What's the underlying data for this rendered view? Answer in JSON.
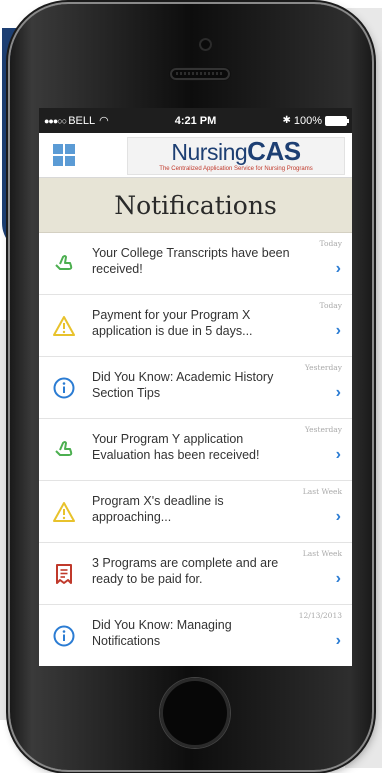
{
  "status_bar": {
    "carrier": "BELL",
    "time": "4:21 PM",
    "battery": "100%"
  },
  "header": {
    "logo_text_light": "Nursing",
    "logo_text_bold": "CAS",
    "logo_tagline": "The Centralized Application Service for Nursing Programs",
    "title": "Notifications"
  },
  "notifications": [
    {
      "icon": "thumbs-up-icon",
      "text": "Your College Transcripts have been received!",
      "date": "Today"
    },
    {
      "icon": "warning-icon",
      "text": "Payment for your Program X application is due in 5 days...",
      "date": "Today"
    },
    {
      "icon": "info-icon",
      "text": "Did You Know: Academic History Section Tips",
      "date": "Yesterday"
    },
    {
      "icon": "thumbs-up-icon",
      "text": "Your Program Y application Evaluation has been received!",
      "date": "Yesterday"
    },
    {
      "icon": "warning-icon",
      "text": "Program X's deadline is approaching...",
      "date": "Last Week"
    },
    {
      "icon": "receipt-icon",
      "text": "3 Programs are complete and are ready to be paid for.",
      "date": "Last Week"
    },
    {
      "icon": "info-icon",
      "text": "Did You Know: Managing Notifications",
      "date": "12/13/2013"
    }
  ],
  "colors": {
    "brand_blue": "#1d3f73",
    "accent_blue": "#2b7cd3",
    "success_green": "#4caf50",
    "warning_yellow": "#e8c22c",
    "alert_red": "#c0392b",
    "title_bar_bg": "#e7e4d6"
  }
}
